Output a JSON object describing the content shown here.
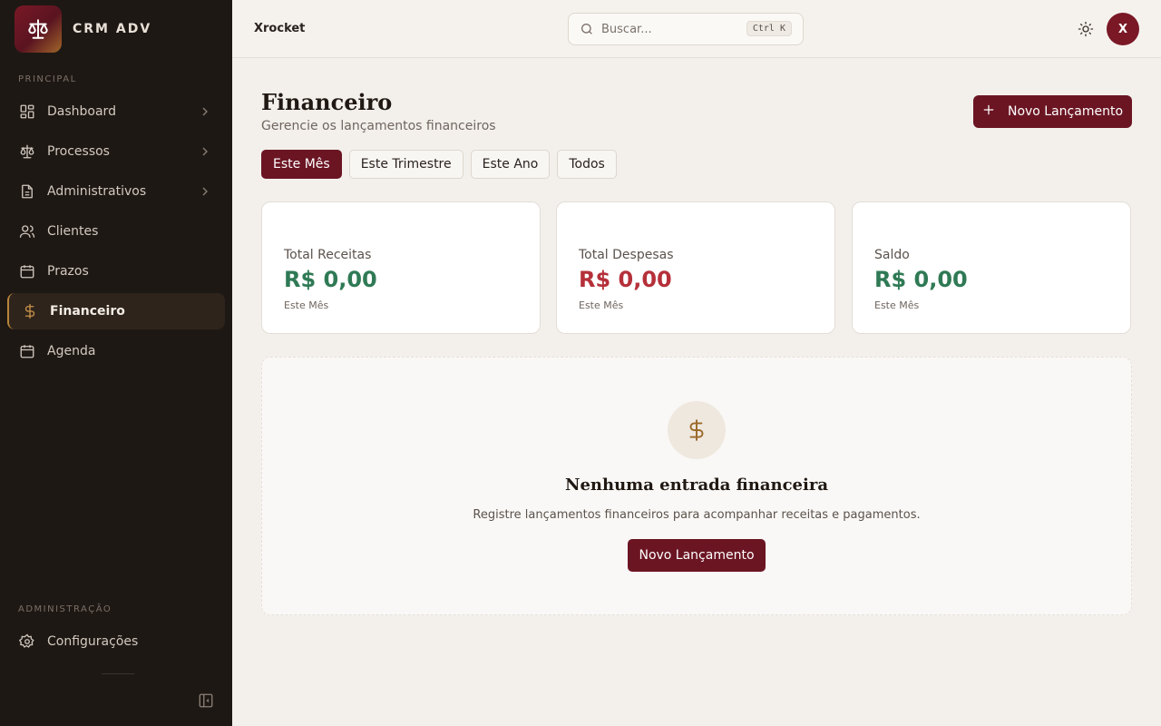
{
  "app": {
    "name": "CRM ADV",
    "workspace": "Xrocket",
    "brand_color": "#6b1523",
    "accent_color": "#b9853a"
  },
  "sidebar": {
    "section_principal": "PRINCIPAL",
    "items": [
      {
        "label": "Dashboard",
        "icon": "layout-dashboard-icon",
        "has_submenu": true
      },
      {
        "label": "Processos",
        "icon": "scale-icon",
        "has_submenu": true
      },
      {
        "label": "Administrativos",
        "icon": "file-text-icon",
        "has_submenu": true
      },
      {
        "label": "Clientes",
        "icon": "users-icon",
        "has_submenu": false
      },
      {
        "label": "Prazos",
        "icon": "calendar-icon",
        "has_submenu": false
      },
      {
        "label": "Financeiro",
        "icon": "dollar-sign-icon",
        "has_submenu": false,
        "active": true
      },
      {
        "label": "Agenda",
        "icon": "calendar-days-icon",
        "has_submenu": false
      }
    ],
    "section_admin": "ADMINISTRAÇÃO",
    "admin_items": [
      {
        "label": "Configurações",
        "icon": "settings-icon"
      }
    ]
  },
  "header": {
    "search_placeholder": "Buscar...",
    "shortcut_ctrl": "Ctrl",
    "shortcut_key": "K",
    "avatar_initial": "X"
  },
  "page": {
    "title": "Financeiro",
    "subtitle": "Gerencie os lançamentos financeiros",
    "new_button": "Novo Lançamento",
    "filters": [
      {
        "label": "Este Mês",
        "active": true
      },
      {
        "label": "Este Trimestre",
        "active": false
      },
      {
        "label": "Este Ano",
        "active": false
      },
      {
        "label": "Todos",
        "active": false
      }
    ],
    "cards": [
      {
        "label": "Total Receitas",
        "value": "R$ 0,00",
        "period": "Este Mês",
        "color": "#2f7a55"
      },
      {
        "label": "Total Despesas",
        "value": "R$ 0,00",
        "period": "Este Mês",
        "color": "#b5303a"
      },
      {
        "label": "Saldo",
        "value": "R$ 0,00",
        "period": "Este Mês",
        "color": "#2f7a55"
      }
    ],
    "empty_state": {
      "icon": "dollar-sign-icon",
      "title": "Nenhuma entrada financeira",
      "description": "Registre lançamentos financeiros para acompanhar receitas e pagamentos.",
      "button": "Novo Lançamento"
    }
  }
}
